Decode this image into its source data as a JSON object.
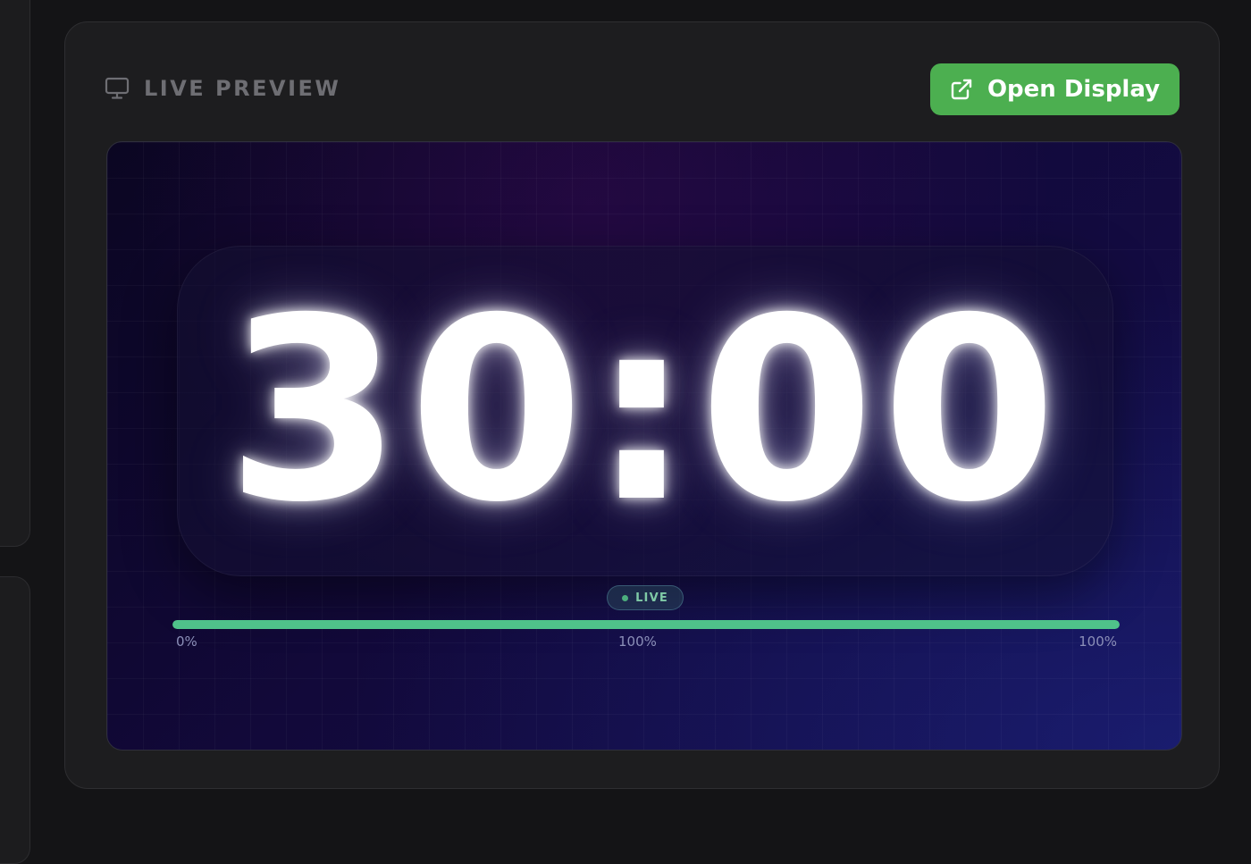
{
  "header": {
    "title": "LIVE PREVIEW",
    "icon": "monitor-icon"
  },
  "open_display_button": {
    "label": "Open Display",
    "icon": "external-link-icon",
    "color": "#4caf50"
  },
  "preview": {
    "timer": "30:00",
    "status_badge": "LIVE",
    "progress": {
      "fraction": 1.0,
      "start_label": "0%",
      "mid_label": "100%",
      "end_label": "100%",
      "color": "#4fc28a"
    }
  }
}
